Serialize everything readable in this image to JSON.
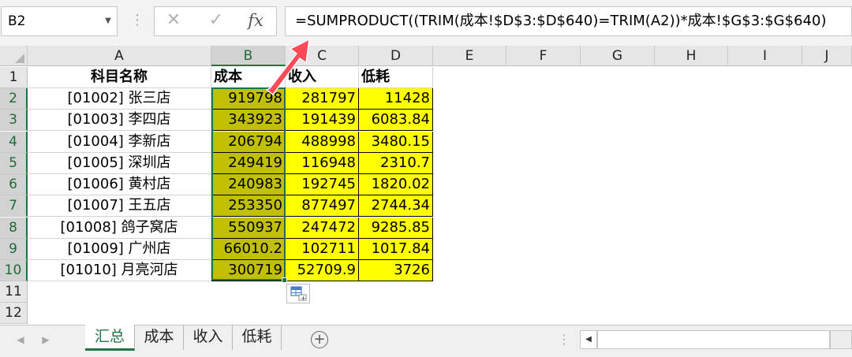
{
  "name_box": {
    "value": "B2"
  },
  "formula_bar": {
    "cancel_icon": "cross-icon",
    "enter_icon": "check-icon",
    "insert_function_label": "fx",
    "formula": "=SUMPRODUCT((TRIM(成本!$D$3:$D$640)=TRIM(A2))*成本!$G$3:$G$640)"
  },
  "columns": [
    "A",
    "B",
    "C",
    "D",
    "E",
    "F",
    "G",
    "H",
    "I",
    "J"
  ],
  "rows": [
    "1",
    "2",
    "3",
    "4",
    "5",
    "6",
    "7",
    "8",
    "9",
    "10",
    "11",
    "12"
  ],
  "header_row": {
    "a": "科目名称",
    "b": "成本",
    "c": "收入",
    "d": "低耗"
  },
  "data_rows": [
    {
      "a": "[01002] 张三店",
      "b": "919798",
      "c": "281797",
      "d": "11428"
    },
    {
      "a": "[01003] 李四店",
      "b": "343923",
      "c": "191439",
      "d": "6083.84"
    },
    {
      "a": "[01004] 李新店",
      "b": "206794",
      "c": "488998",
      "d": "3480.15"
    },
    {
      "a": "[01005] 深圳店",
      "b": "249419",
      "c": "116948",
      "d": "2310.7"
    },
    {
      "a": "[01006] 黄村店",
      "b": "240983",
      "c": "192745",
      "d": "1820.02"
    },
    {
      "a": "[01007] 王五店",
      "b": "253350",
      "c": "877497",
      "d": "2744.34"
    },
    {
      "a": "[01008] 鸽子窝店",
      "b": "550937",
      "c": "247472",
      "d": "9285.85"
    },
    {
      "a": "[01009] 广州店",
      "b": "66010.2",
      "c": "102711",
      "d": "1017.84"
    },
    {
      "a": "[01010] 月亮河店",
      "b": "300719",
      "c": "52709.9",
      "d": "3726"
    }
  ],
  "sheet_tabs": [
    "汇总",
    "成本",
    "收入",
    "低耗"
  ],
  "active_sheet": "汇总",
  "colors": {
    "highlight": "#ffff00",
    "selection_fill": "#c0c000",
    "accent": "#217346",
    "arrow": "#ff4a5a"
  }
}
